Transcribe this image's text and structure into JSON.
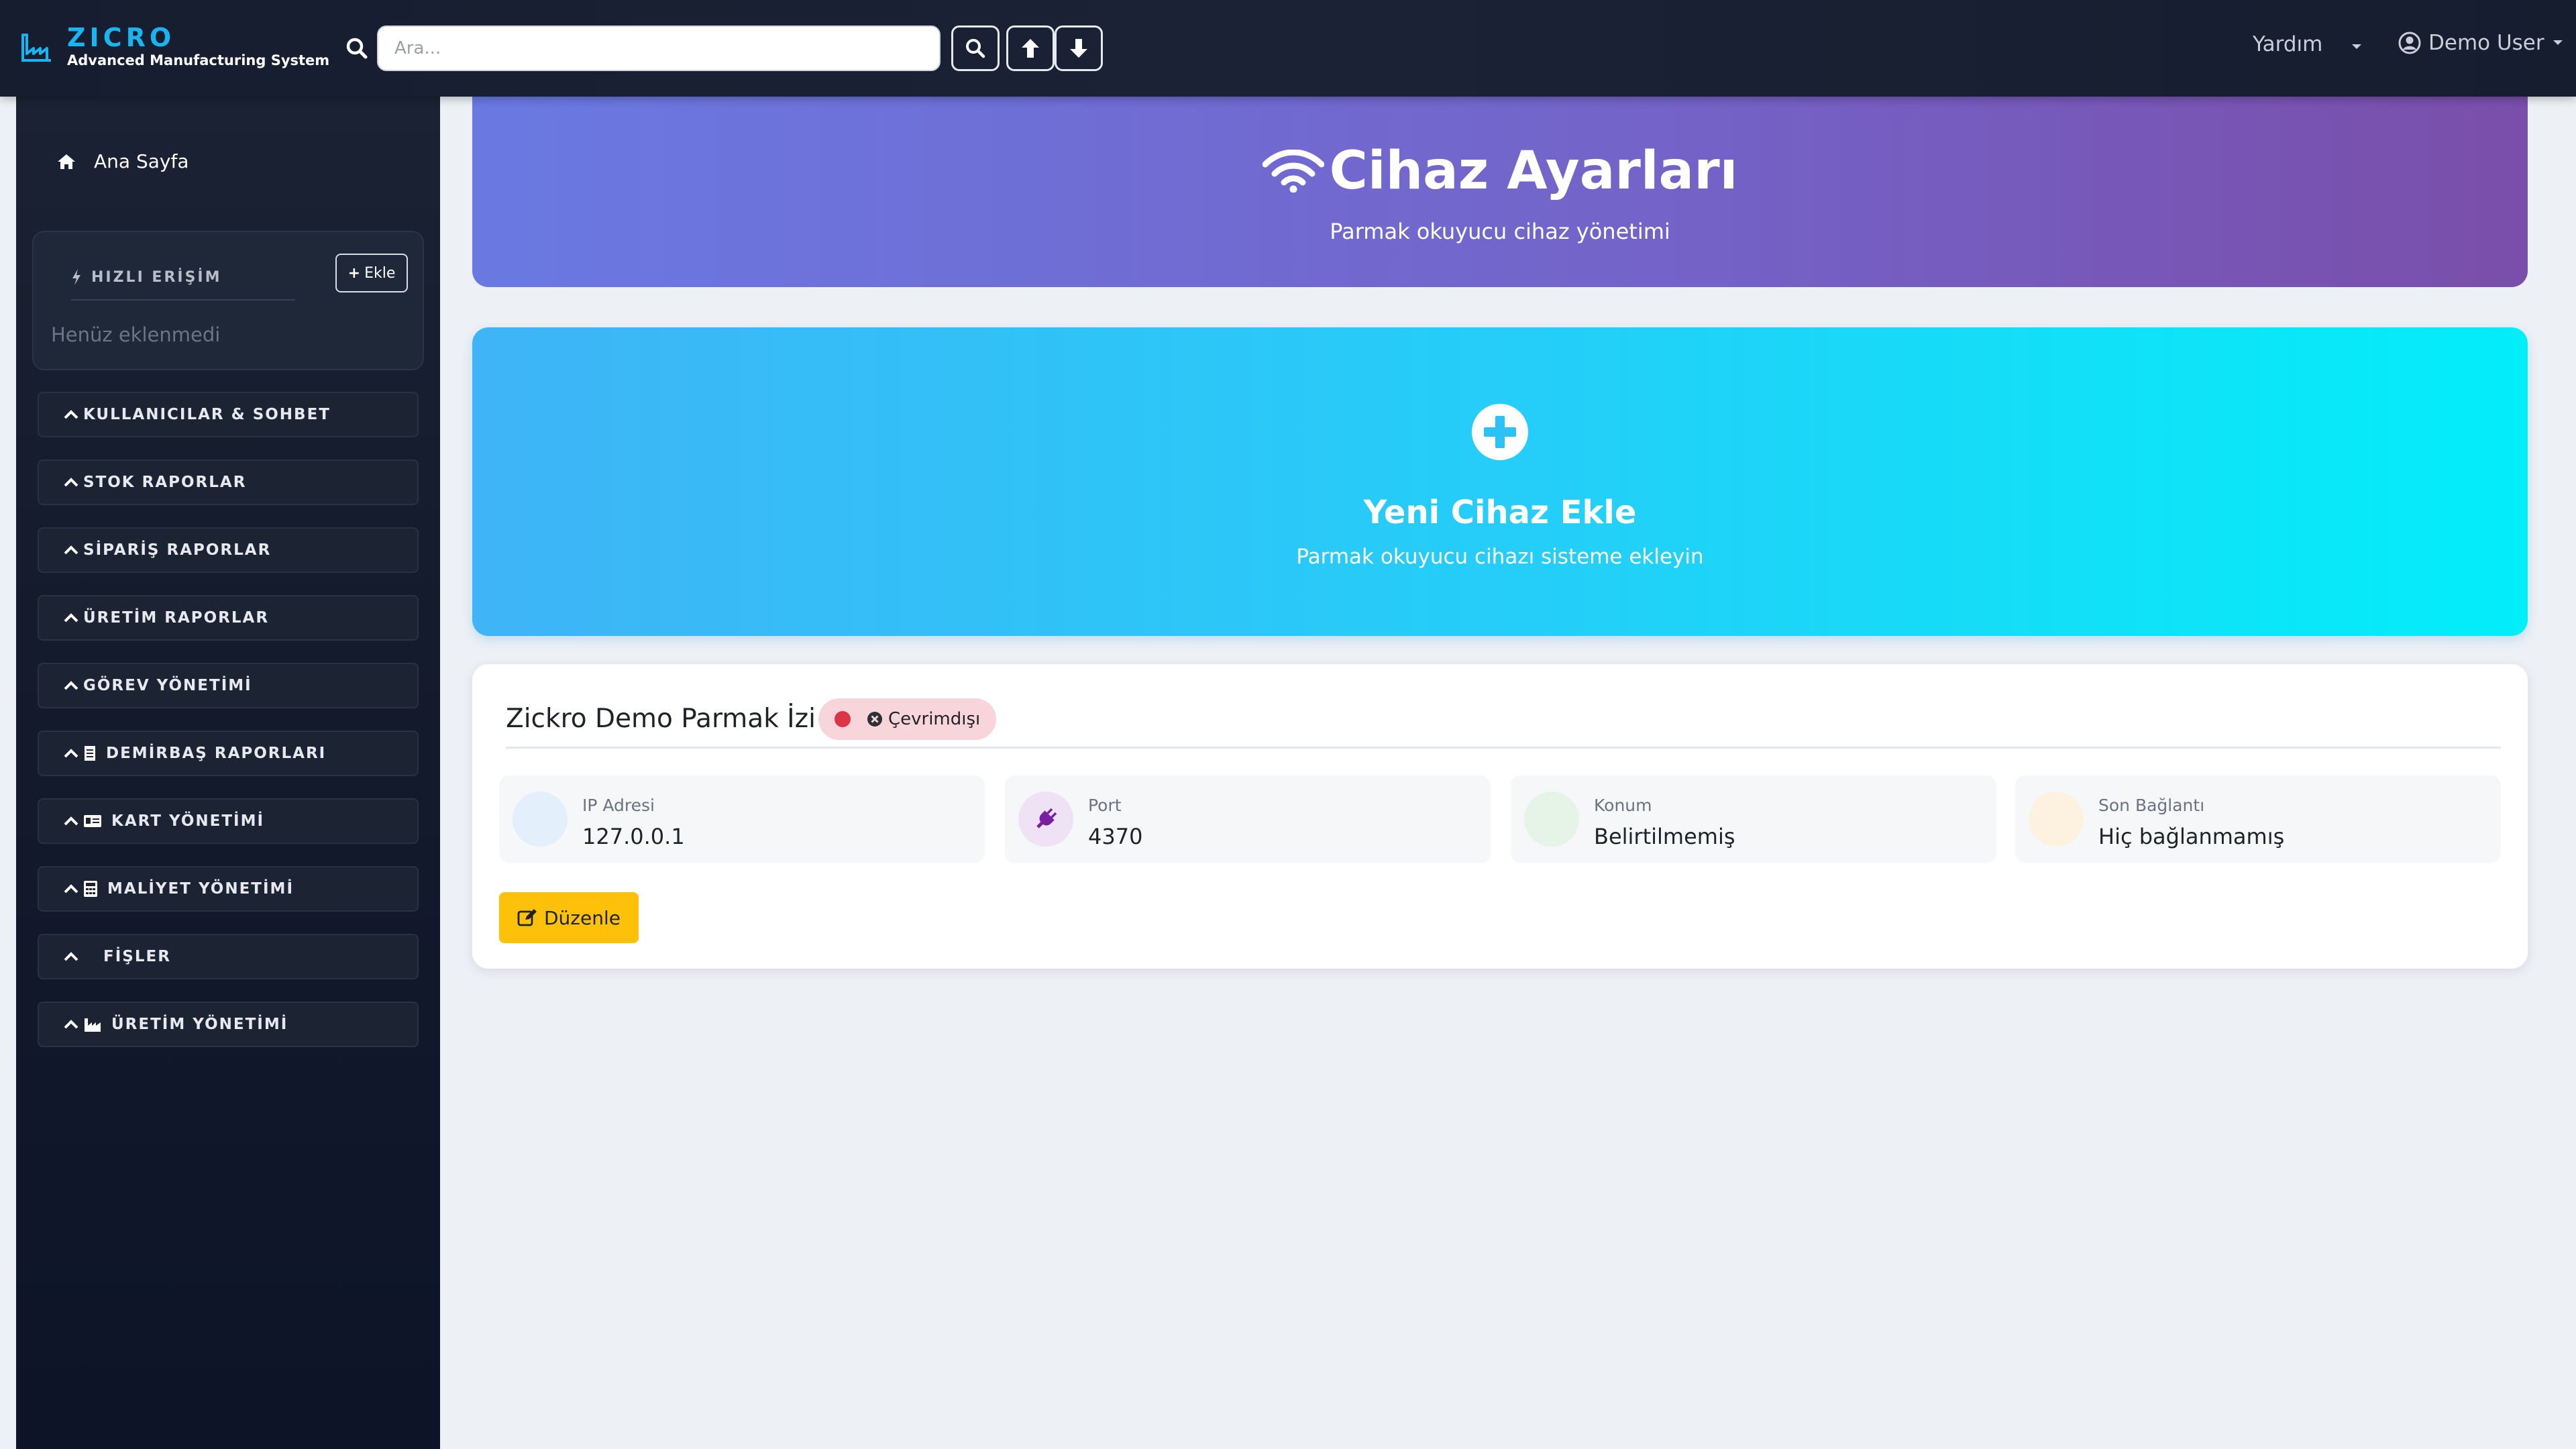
{
  "navbar": {
    "brand_name": "ZICRO",
    "brand_sub": "Advanced Manufacturing System",
    "search_placeholder": "Ara...",
    "help_label": "Yardım",
    "user_label": "Demo User"
  },
  "sidebar": {
    "home_label": "Ana Sayfa",
    "quick_access": {
      "title": "HIZLI ERİŞİM",
      "add_label": "Ekle",
      "empty_text": "Henüz eklenmedi"
    },
    "sections": [
      {
        "label": "KULLANICILAR & SOHBET",
        "icon": "none"
      },
      {
        "label": "STOK RAPORLAR",
        "icon": "none"
      },
      {
        "label": "SİPARİŞ RAPORLAR",
        "icon": "none"
      },
      {
        "label": "ÜRETİM RAPORLAR",
        "icon": "none"
      },
      {
        "label": "GÖREV YÖNETİMİ",
        "icon": "none"
      },
      {
        "label": "DEMİRBAŞ RAPORLARI",
        "icon": "document-icon"
      },
      {
        "label": "KART YÖNETİMİ",
        "icon": "id-card-icon"
      },
      {
        "label": "MALİYET YÖNETİMİ",
        "icon": "calculator-icon"
      },
      {
        "label": "FİŞLER",
        "icon": "receipt-icon"
      },
      {
        "label": "ÜRETİM YÖNETİMİ",
        "icon": "factory-icon"
      }
    ]
  },
  "hero": {
    "title": "Cihaz Ayarları",
    "subtitle": "Parmak okuyucu cihaz yönetimi"
  },
  "add_device": {
    "title": "Yeni Cihaz Ekle",
    "subtitle": "Parmak okuyucu cihazı sisteme ekleyin"
  },
  "device": {
    "name": "Zickro Demo Parmak İzi",
    "status": "Çevrimdışı",
    "stats": [
      {
        "label": "IP Adresi",
        "value": "127.0.0.1"
      },
      {
        "label": "Port",
        "value": "4370"
      },
      {
        "label": "Konum",
        "value": "Belirtilmemiş"
      },
      {
        "label": "Son Bağlantı",
        "value": "Hiç bağlanmamış"
      }
    ],
    "edit_label": "Düzenle"
  },
  "colors": {
    "brand": "#19b5f0",
    "status_offline": "#dc3545",
    "edit_button": "#fdc10a"
  }
}
